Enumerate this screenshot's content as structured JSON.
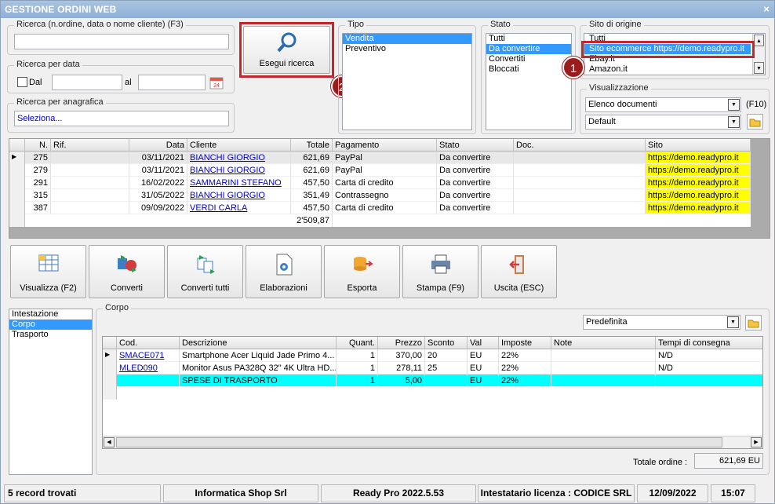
{
  "window": {
    "title": "GESTIONE ORDINI WEB",
    "close": "×"
  },
  "search": {
    "label": "Ricerca (n.ordine, data o nome cliente) (F3)",
    "value": ""
  },
  "date": {
    "label": "Ricerca per data",
    "from_label": "Dal",
    "to_label": "al"
  },
  "registry": {
    "label": "Ricerca per anagrafica",
    "value": "Seleziona..."
  },
  "search_button": {
    "label": "Esegui ricerca"
  },
  "tipo": {
    "label": "Tipo",
    "items": [
      "Vendita",
      "Preventivo"
    ],
    "selected": "Vendita"
  },
  "stato": {
    "label": "Stato",
    "items": [
      "Tutti",
      "Da convertire",
      "Convertiti",
      "Bloccati"
    ],
    "selected": "Da convertire"
  },
  "sito": {
    "label": "Sito di origine",
    "items": [
      "Tutti",
      "Sito ecommerce https://demo.readypro.it",
      "Ebay.it",
      "Amazon.it"
    ],
    "selected": "Sito ecommerce https://demo.readypro.it"
  },
  "visualizzazione": {
    "label": "Visualizzazione",
    "view": "Elenco documenti",
    "shortcut": "(F10)",
    "layout": "Default"
  },
  "badges": {
    "one": "1",
    "two": "2"
  },
  "orders": {
    "headers": [
      "N.",
      "Rif.",
      "Data",
      "Cliente",
      "Totale",
      "Pagamento",
      "Stato",
      "Doc.",
      "Sito"
    ],
    "rows": [
      [
        "275",
        "",
        "03/11/2021",
        "BIANCHI GIORGIO",
        "621,69",
        "PayPal",
        "Da convertire",
        "",
        "https://demo.readypro.it"
      ],
      [
        "279",
        "",
        "03/11/2021",
        "BIANCHI GIORGIO",
        "621,69",
        "PayPal",
        "Da convertire",
        "",
        "https://demo.readypro.it"
      ],
      [
        "291",
        "",
        "16/02/2022",
        "SAMMARINI STEFANO",
        "457,50",
        "Carta di credito",
        "Da convertire",
        "",
        "https://demo.readypro.it"
      ],
      [
        "315",
        "",
        "31/05/2022",
        "BIANCHI GIORGIO",
        "351,49",
        "Contrassegno",
        "Da convertire",
        "",
        "https://demo.readypro.it"
      ],
      [
        "387",
        "",
        "09/09/2022",
        "VERDI CARLA",
        "457,50",
        "Carta di credito",
        "Da convertire",
        "",
        "https://demo.readypro.it"
      ]
    ],
    "total": "2'509,87"
  },
  "toolbar": {
    "visualizza": "Visualizza (F2)",
    "converti": "Converti",
    "converti_tutti": "Converti tutti",
    "elaborazioni": "Elaborazioni",
    "esporta": "Esporta",
    "stampa": "Stampa (F9)",
    "uscita": "Uscita (ESC)"
  },
  "sections": {
    "items": [
      "Intestazione",
      "Corpo",
      "Trasporto"
    ],
    "selected": "Corpo"
  },
  "corpo": {
    "label": "Corpo",
    "preset": "Predefinita",
    "headers": [
      "Cod.",
      "Descrizione",
      "Quant.",
      "Prezzo",
      "Sconto",
      "Val",
      "Imposte",
      "Note",
      "Tempi di consegna"
    ],
    "rows": [
      [
        "SMACE071",
        "Smartphone Acer Liquid Jade Primo 4...",
        "1",
        "370,00",
        "20",
        "EU",
        "22%",
        "",
        "N/D"
      ],
      [
        "MLED090",
        "Monitor Asus PA328Q 32\" 4K Ultra HD...",
        "1",
        "278,11",
        "25",
        "EU",
        "22%",
        "",
        "N/D"
      ],
      [
        "",
        "SPESE DI TRASPORTO",
        "1",
        "5,00",
        "",
        "EU",
        "22%",
        "",
        ""
      ]
    ],
    "total_label": "Totale ordine :",
    "total_value": "621,69 EU"
  },
  "statusbar": {
    "records": "5 record trovati",
    "company": "Informatica Shop Srl",
    "version": "Ready Pro 2022.5.53",
    "license": "Intestatario licenza : CODICE SRL",
    "date": "12/09/2022",
    "time": "15:07"
  },
  "colors": {
    "title": "#9bb9dc",
    "select": "#3399ff",
    "site_highlight": "#ffff00",
    "shipping_row": "#00ffff",
    "badge": "#9a1c1c"
  }
}
